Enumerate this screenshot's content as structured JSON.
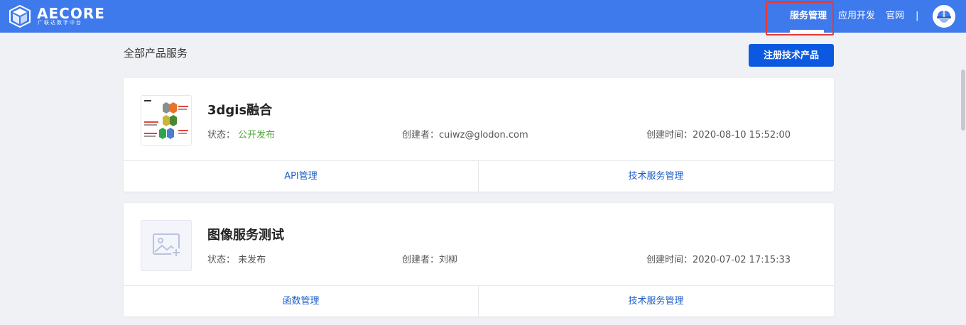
{
  "header": {
    "logo_text": "AECORE",
    "logo_subtitle": "广联达数字中台",
    "nav": [
      {
        "label": "服务管理",
        "active": true
      },
      {
        "label": "应用开发",
        "active": false
      },
      {
        "label": "官网",
        "active": false
      }
    ],
    "separator": "|"
  },
  "page": {
    "title": "全部产品服务",
    "register_button": "注册技术产品"
  },
  "cards": [
    {
      "title": "3dgis融合",
      "status_label": "状态：",
      "status_value": "公开发布",
      "creator": "创建者：cuiwz@glodon.com",
      "created_time": "创建时间：2020-08-10 15:52:00",
      "footer": [
        "API管理",
        "技术服务管理"
      ]
    },
    {
      "title": "图像服务测试",
      "status_label": "状态：",
      "status_value": "未发布",
      "creator": "创建者：刘柳",
      "created_time": "创建时间：2020-07-02 17:15:33",
      "footer": [
        "函数管理",
        "技术服务管理"
      ]
    }
  ],
  "colors": {
    "header_bg": "#3e7aec",
    "primary_button": "#0b59e0",
    "link": "#1f5fc6",
    "published": "#52a83a",
    "highlight": "#e53935"
  }
}
